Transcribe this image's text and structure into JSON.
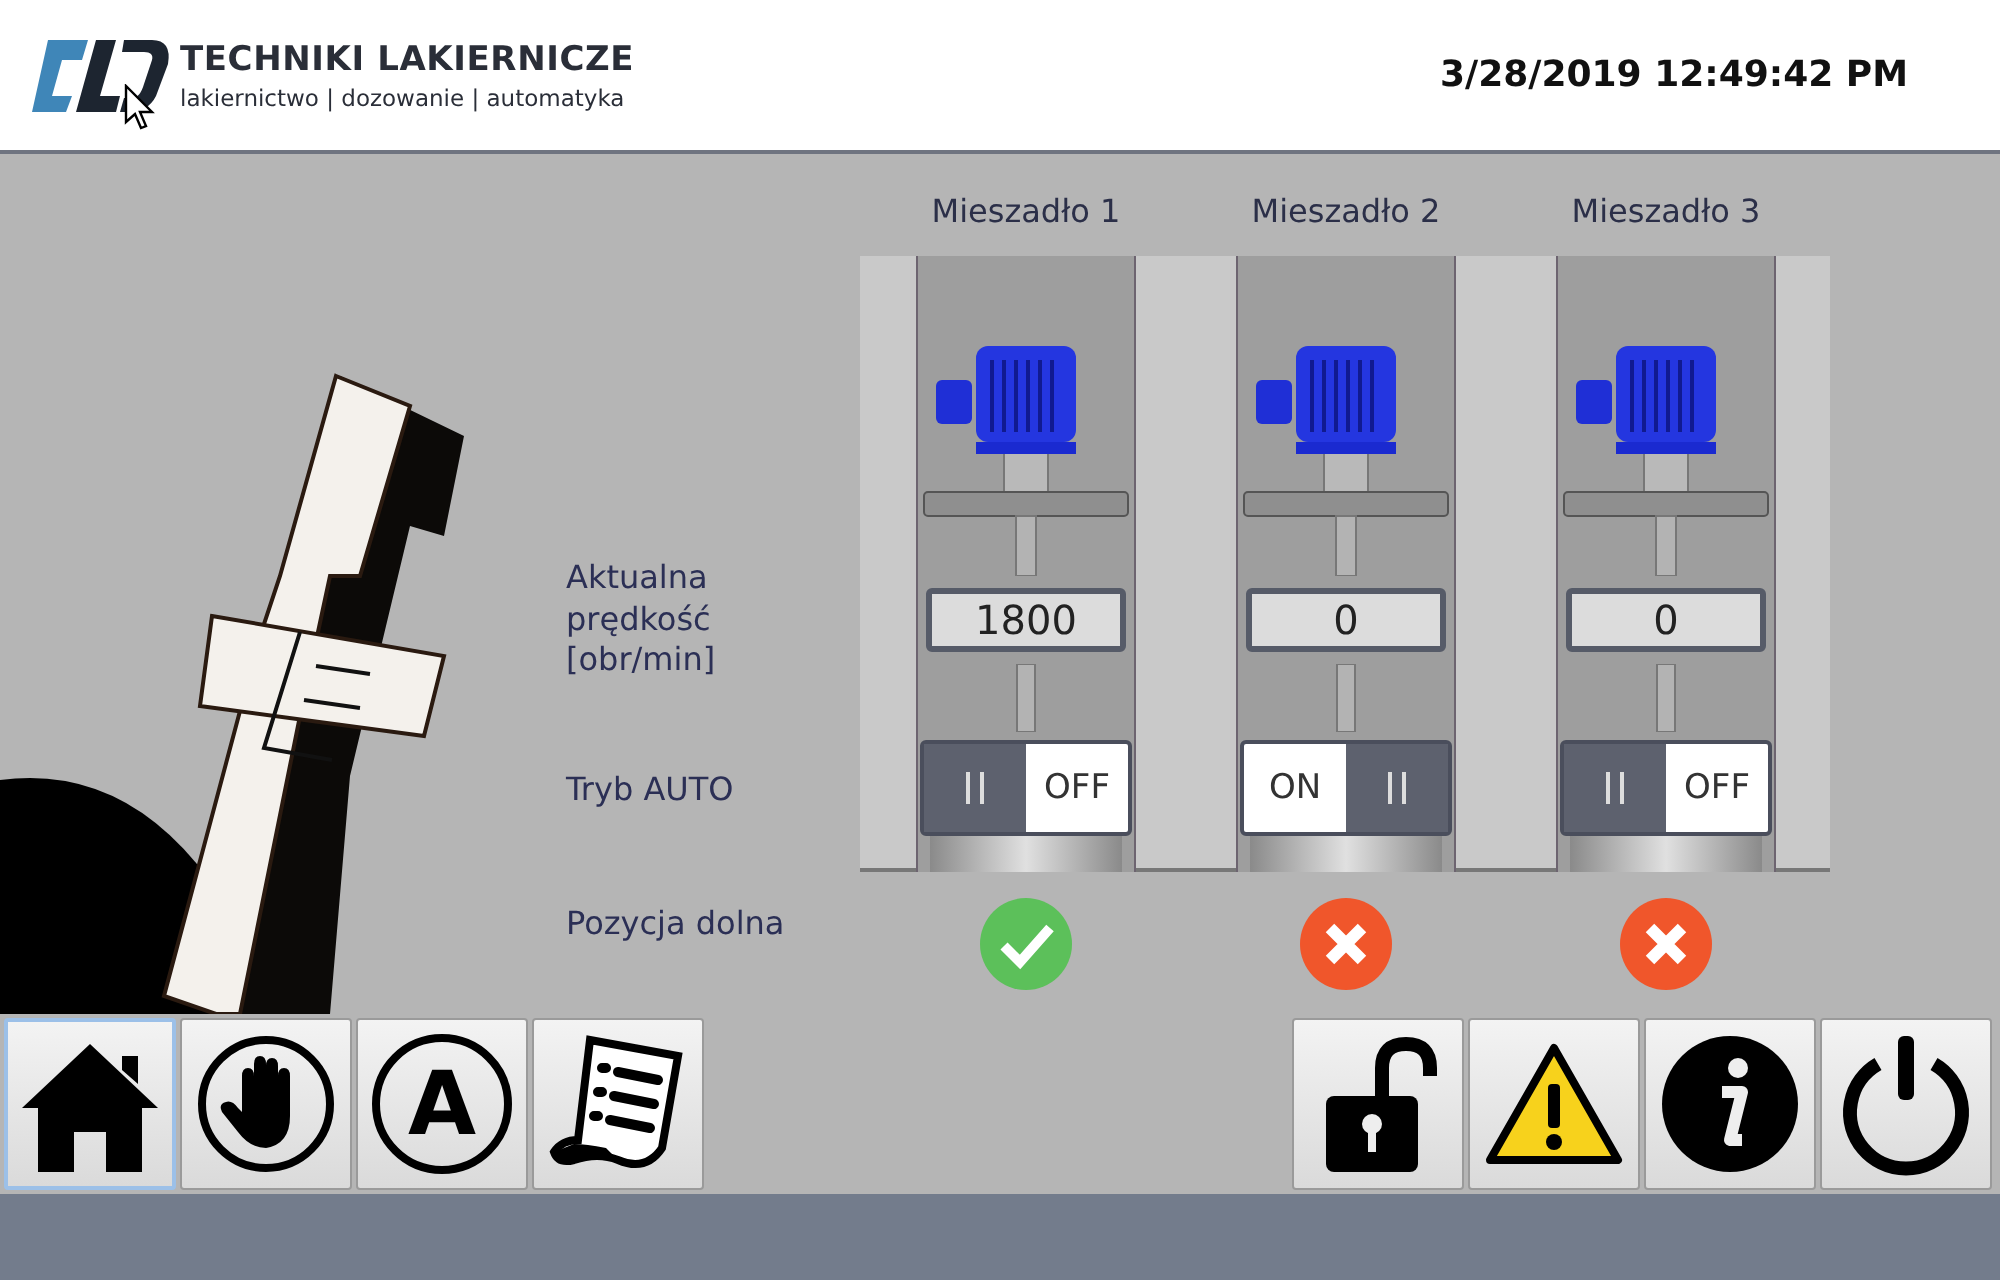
{
  "header": {
    "company_name": "TECHNIKI LAKIERNICZE",
    "tagline": "lakiernictwo | dozowanie | automatyka",
    "datetime": "3/28/2019 12:49:42 PM"
  },
  "row_labels": {
    "speed": "Aktualna prędkość [obr/min]",
    "auto_mode": "Tryb AUTO",
    "lower_position": "Pozycja dolna"
  },
  "mixers": [
    {
      "name": "Mieszadło 1",
      "speed": "1800",
      "auto_on": false,
      "toggle_label": "OFF",
      "lower_position_ok": true
    },
    {
      "name": "Mieszadło 2",
      "speed": "0",
      "auto_on": true,
      "toggle_label": "ON",
      "lower_position_ok": false
    },
    {
      "name": "Mieszadło 3",
      "speed": "0",
      "auto_on": false,
      "toggle_label": "OFF",
      "lower_position_ok": false
    }
  ],
  "nav_buttons_left": [
    {
      "kind": "home",
      "selected": true
    },
    {
      "kind": "manual",
      "selected": false
    },
    {
      "kind": "auto",
      "label": "A",
      "selected": false
    },
    {
      "kind": "report",
      "selected": false
    }
  ],
  "nav_buttons_right": [
    {
      "kind": "unlock"
    },
    {
      "kind": "warning"
    },
    {
      "kind": "info"
    },
    {
      "kind": "power"
    }
  ]
}
